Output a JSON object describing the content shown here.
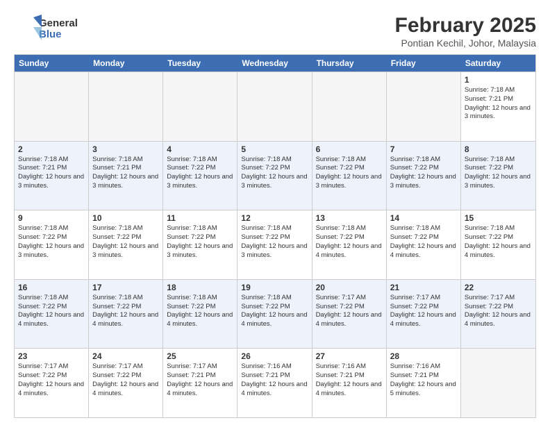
{
  "logo": {
    "line1": "General",
    "line2": "Blue"
  },
  "title": "February 2025",
  "subtitle": "Pontian Kechil, Johor, Malaysia",
  "weekdays": [
    "Sunday",
    "Monday",
    "Tuesday",
    "Wednesday",
    "Thursday",
    "Friday",
    "Saturday"
  ],
  "weeks": [
    [
      {
        "day": "",
        "info": ""
      },
      {
        "day": "",
        "info": ""
      },
      {
        "day": "",
        "info": ""
      },
      {
        "day": "",
        "info": ""
      },
      {
        "day": "",
        "info": ""
      },
      {
        "day": "",
        "info": ""
      },
      {
        "day": "1",
        "sunrise": "Sunrise: 7:18 AM",
        "sunset": "Sunset: 7:21 PM",
        "daylight": "Daylight: 12 hours and 3 minutes."
      }
    ],
    [
      {
        "day": "2",
        "sunrise": "Sunrise: 7:18 AM",
        "sunset": "Sunset: 7:21 PM",
        "daylight": "Daylight: 12 hours and 3 minutes."
      },
      {
        "day": "3",
        "sunrise": "Sunrise: 7:18 AM",
        "sunset": "Sunset: 7:21 PM",
        "daylight": "Daylight: 12 hours and 3 minutes."
      },
      {
        "day": "4",
        "sunrise": "Sunrise: 7:18 AM",
        "sunset": "Sunset: 7:22 PM",
        "daylight": "Daylight: 12 hours and 3 minutes."
      },
      {
        "day": "5",
        "sunrise": "Sunrise: 7:18 AM",
        "sunset": "Sunset: 7:22 PM",
        "daylight": "Daylight: 12 hours and 3 minutes."
      },
      {
        "day": "6",
        "sunrise": "Sunrise: 7:18 AM",
        "sunset": "Sunset: 7:22 PM",
        "daylight": "Daylight: 12 hours and 3 minutes."
      },
      {
        "day": "7",
        "sunrise": "Sunrise: 7:18 AM",
        "sunset": "Sunset: 7:22 PM",
        "daylight": "Daylight: 12 hours and 3 minutes."
      },
      {
        "day": "8",
        "sunrise": "Sunrise: 7:18 AM",
        "sunset": "Sunset: 7:22 PM",
        "daylight": "Daylight: 12 hours and 3 minutes."
      }
    ],
    [
      {
        "day": "9",
        "sunrise": "Sunrise: 7:18 AM",
        "sunset": "Sunset: 7:22 PM",
        "daylight": "Daylight: 12 hours and 3 minutes."
      },
      {
        "day": "10",
        "sunrise": "Sunrise: 7:18 AM",
        "sunset": "Sunset: 7:22 PM",
        "daylight": "Daylight: 12 hours and 3 minutes."
      },
      {
        "day": "11",
        "sunrise": "Sunrise: 7:18 AM",
        "sunset": "Sunset: 7:22 PM",
        "daylight": "Daylight: 12 hours and 3 minutes."
      },
      {
        "day": "12",
        "sunrise": "Sunrise: 7:18 AM",
        "sunset": "Sunset: 7:22 PM",
        "daylight": "Daylight: 12 hours and 3 minutes."
      },
      {
        "day": "13",
        "sunrise": "Sunrise: 7:18 AM",
        "sunset": "Sunset: 7:22 PM",
        "daylight": "Daylight: 12 hours and 4 minutes."
      },
      {
        "day": "14",
        "sunrise": "Sunrise: 7:18 AM",
        "sunset": "Sunset: 7:22 PM",
        "daylight": "Daylight: 12 hours and 4 minutes."
      },
      {
        "day": "15",
        "sunrise": "Sunrise: 7:18 AM",
        "sunset": "Sunset: 7:22 PM",
        "daylight": "Daylight: 12 hours and 4 minutes."
      }
    ],
    [
      {
        "day": "16",
        "sunrise": "Sunrise: 7:18 AM",
        "sunset": "Sunset: 7:22 PM",
        "daylight": "Daylight: 12 hours and 4 minutes."
      },
      {
        "day": "17",
        "sunrise": "Sunrise: 7:18 AM",
        "sunset": "Sunset: 7:22 PM",
        "daylight": "Daylight: 12 hours and 4 minutes."
      },
      {
        "day": "18",
        "sunrise": "Sunrise: 7:18 AM",
        "sunset": "Sunset: 7:22 PM",
        "daylight": "Daylight: 12 hours and 4 minutes."
      },
      {
        "day": "19",
        "sunrise": "Sunrise: 7:18 AM",
        "sunset": "Sunset: 7:22 PM",
        "daylight": "Daylight: 12 hours and 4 minutes."
      },
      {
        "day": "20",
        "sunrise": "Sunrise: 7:17 AM",
        "sunset": "Sunset: 7:22 PM",
        "daylight": "Daylight: 12 hours and 4 minutes."
      },
      {
        "day": "21",
        "sunrise": "Sunrise: 7:17 AM",
        "sunset": "Sunset: 7:22 PM",
        "daylight": "Daylight: 12 hours and 4 minutes."
      },
      {
        "day": "22",
        "sunrise": "Sunrise: 7:17 AM",
        "sunset": "Sunset: 7:22 PM",
        "daylight": "Daylight: 12 hours and 4 minutes."
      }
    ],
    [
      {
        "day": "23",
        "sunrise": "Sunrise: 7:17 AM",
        "sunset": "Sunset: 7:22 PM",
        "daylight": "Daylight: 12 hours and 4 minutes."
      },
      {
        "day": "24",
        "sunrise": "Sunrise: 7:17 AM",
        "sunset": "Sunset: 7:22 PM",
        "daylight": "Daylight: 12 hours and 4 minutes."
      },
      {
        "day": "25",
        "sunrise": "Sunrise: 7:17 AM",
        "sunset": "Sunset: 7:21 PM",
        "daylight": "Daylight: 12 hours and 4 minutes."
      },
      {
        "day": "26",
        "sunrise": "Sunrise: 7:16 AM",
        "sunset": "Sunset: 7:21 PM",
        "daylight": "Daylight: 12 hours and 4 minutes."
      },
      {
        "day": "27",
        "sunrise": "Sunrise: 7:16 AM",
        "sunset": "Sunset: 7:21 PM",
        "daylight": "Daylight: 12 hours and 4 minutes."
      },
      {
        "day": "28",
        "sunrise": "Sunrise: 7:16 AM",
        "sunset": "Sunset: 7:21 PM",
        "daylight": "Daylight: 12 hours and 5 minutes."
      },
      {
        "day": "",
        "info": ""
      }
    ]
  ]
}
